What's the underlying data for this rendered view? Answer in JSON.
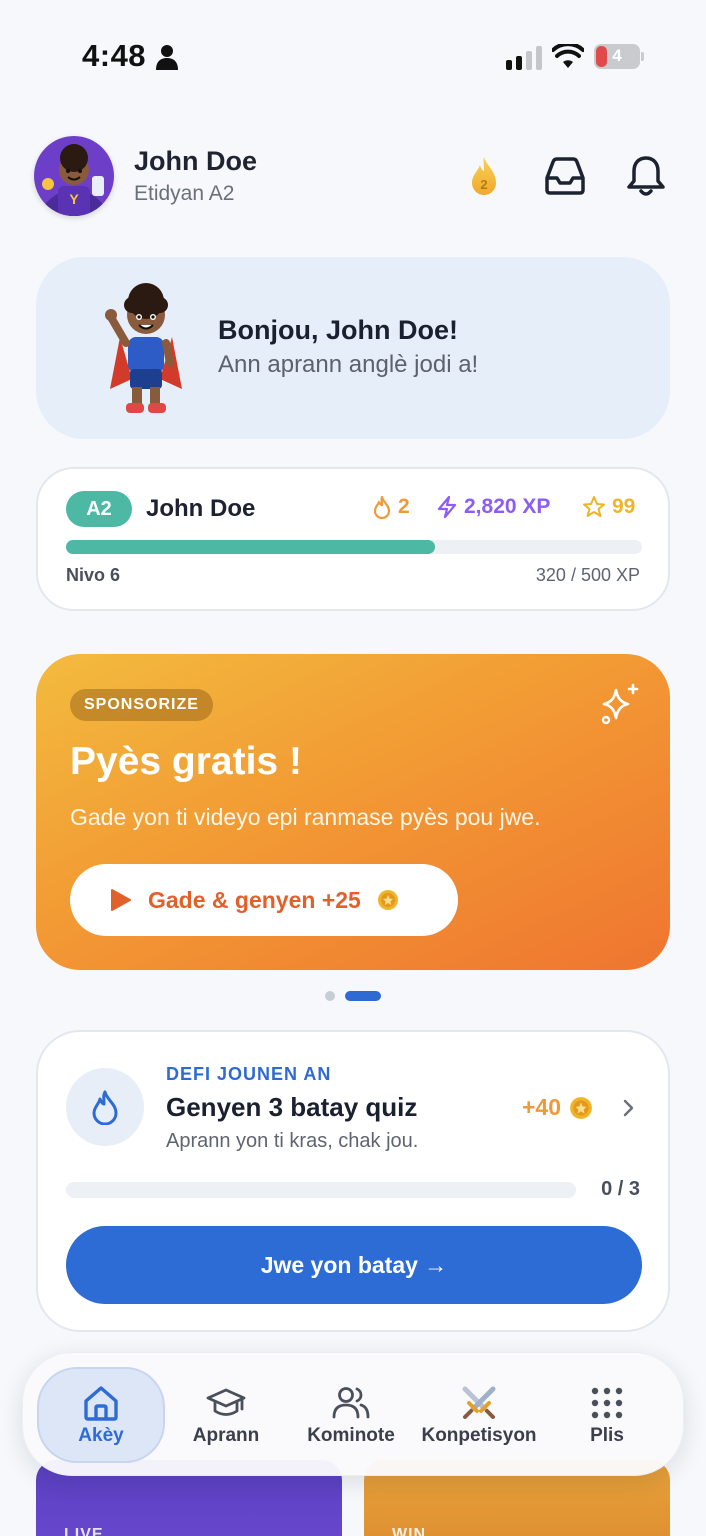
{
  "status_bar": {
    "time": "4:48",
    "battery": "4"
  },
  "header": {
    "name": "John Doe",
    "level": "Etidyan A2",
    "streak_badge": "2"
  },
  "greeting": {
    "title": "Bonjou, John Doe!",
    "subtitle": "Ann aprann anglè jodi a!"
  },
  "progress": {
    "badge": "A2",
    "name": "John Doe",
    "streak": "2",
    "xp": "2,820 XP",
    "stars": "99",
    "level_label": "Nivo 6",
    "xp_count": "320 / 500 XP",
    "xp_fraction": 0.64
  },
  "sponsor": {
    "tag": "SPONSORIZE",
    "title": "Pyès gratis !",
    "subtitle": "Gade yon ti videyo epi ranmase pyès pou jwe.",
    "button_label": "Gade & genyen +25"
  },
  "carousel": {
    "active_index": 1,
    "count": 2
  },
  "challenge": {
    "tag": "DEFI JOUNEN AN",
    "title": "Genyen 3 batay quiz",
    "subtitle": "Aprann yon ti kras, chak jou.",
    "reward": "+40",
    "count": "0 / 3",
    "progress_fraction": 0,
    "button_label": "Jwe yon batay →"
  },
  "peek_cards": {
    "live_label": "LIVE",
    "win_label": "WIN"
  },
  "nav": {
    "items": [
      {
        "label": "Akèy",
        "icon": "home-icon"
      },
      {
        "label": "Aprann",
        "icon": "graduation-cap-icon"
      },
      {
        "label": "Kominote",
        "icon": "users-icon"
      },
      {
        "label": "Konpetisyon",
        "icon": "swords-icon"
      },
      {
        "label": "Plis",
        "icon": "grid-icon"
      }
    ],
    "active": 0
  },
  "colors": {
    "accent_blue": "#2d6bd5",
    "teal": "#4db8a4",
    "orange": "#ee9a3a",
    "purple": "#8b5cf6"
  }
}
